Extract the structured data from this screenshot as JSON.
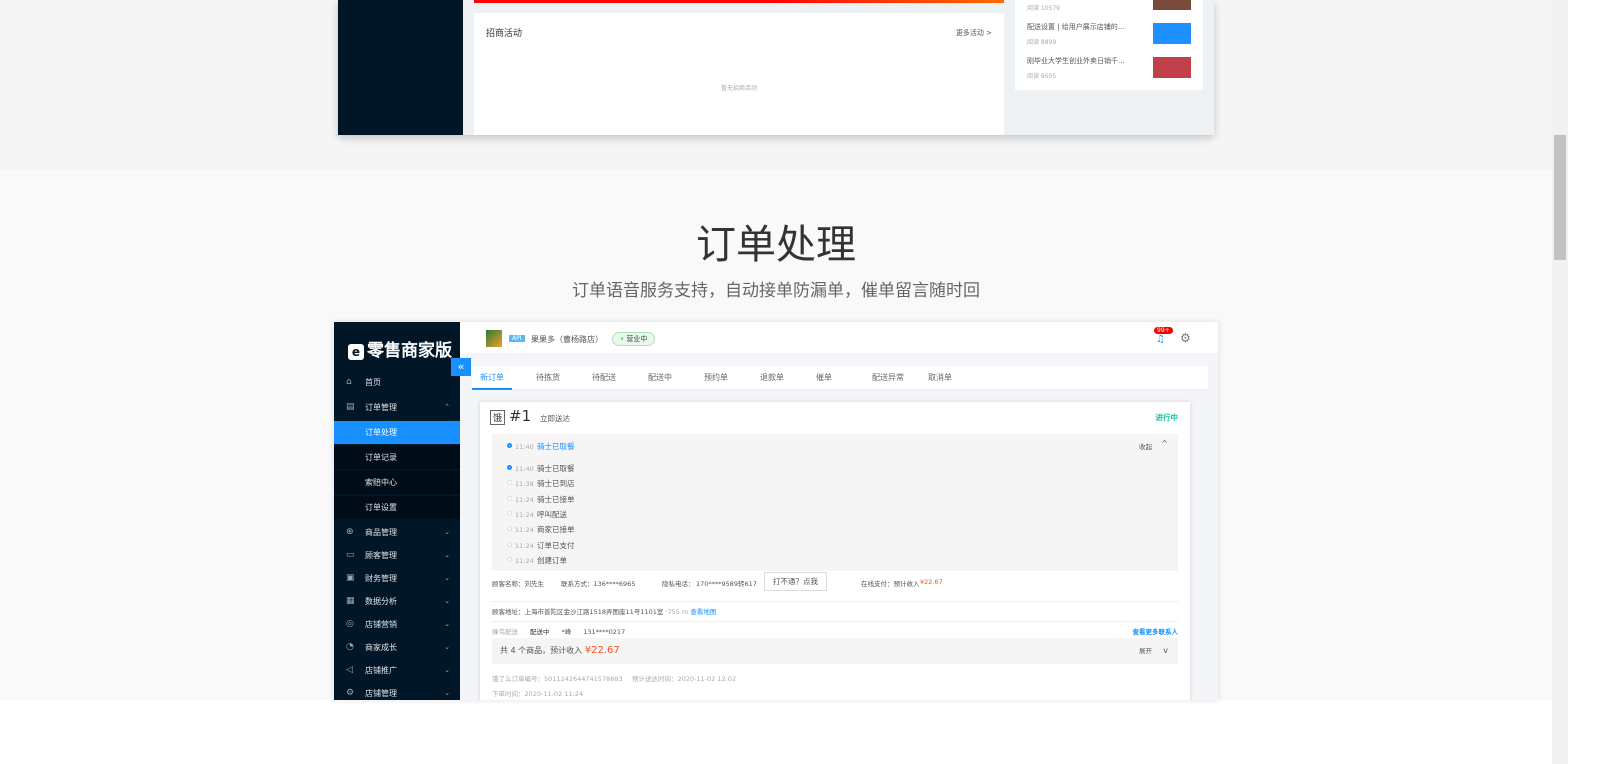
{
  "prev_screenshot": {
    "campaign_title": "招商活动",
    "more_campaigns": "更多活动 >",
    "empty": "暂无招商活动",
    "articles": [
      {
        "title": "",
        "reads": "阅读 10579"
      },
      {
        "title": "配送设置 | 给用户展示店铺的...",
        "reads": "阅读 8899"
      },
      {
        "title": "刚毕业大学生创业外卖日销千...",
        "reads": "阅读 9505"
      }
    ]
  },
  "section": {
    "title": "订单处理",
    "subtitle": "订单语音服务支持，自动接单防漏单，催单留言随时回"
  },
  "app": {
    "logo": "零售商家版",
    "collapse_icon": "«",
    "menu": [
      {
        "label": "首页",
        "icon": "⌂"
      },
      {
        "label": "订单管理",
        "icon": "▤",
        "chevron": "⌃"
      },
      {
        "label": "订单处理",
        "sub": true,
        "active": true
      },
      {
        "label": "订单记录",
        "sub": true
      },
      {
        "label": "索赔中心",
        "sub": true
      },
      {
        "label": "订单设置",
        "sub": true
      },
      {
        "label": "商品管理",
        "icon": "⊕",
        "chevron": "⌄"
      },
      {
        "label": "顾客管理",
        "icon": "▭",
        "chevron": "⌄"
      },
      {
        "label": "财务管理",
        "icon": "▣",
        "chevron": "⌄"
      },
      {
        "label": "数据分析",
        "icon": "▦",
        "chevron": "⌄"
      },
      {
        "label": "店铺营销",
        "icon": "◎",
        "chevron": "⌄"
      },
      {
        "label": "商家成长",
        "icon": "◔",
        "chevron": "⌄"
      },
      {
        "label": "店铺推广",
        "icon": "◁",
        "chevron": "⌄"
      },
      {
        "label": "店铺管理",
        "icon": "⚙",
        "chevron": "⌄"
      }
    ],
    "header": {
      "api": "API",
      "store": "果果多（曹杨路店）",
      "status": "营业中",
      "badge": "99+"
    },
    "tabs": [
      "新订单",
      "待拣货",
      "待配送",
      "配送中",
      "预约单",
      "退款单",
      "催单",
      "配送异常",
      "取消单"
    ],
    "order": {
      "tag": "饿",
      "number": "#1",
      "delivery": "立即送达",
      "state": "进行中",
      "latest": {
        "time": "11:40",
        "text": "骑士已取餐"
      },
      "collapse": "收起",
      "timeline": [
        {
          "time": "11:40",
          "text": "骑士已取餐"
        },
        {
          "time": "11:38",
          "text": "骑士已到店"
        },
        {
          "time": "11:24",
          "text": "骑士已接单"
        },
        {
          "time": "11:24",
          "text": "呼叫配送"
        },
        {
          "time": "11:24",
          "text": "商家已接单"
        },
        {
          "time": "11:24",
          "text": "订单已支付"
        },
        {
          "time": "11:24",
          "text": "创建订单"
        }
      ],
      "customer": "顾客名称：刘先生",
      "contact": "联系方式：136****6965",
      "privacy": "隐私电话：",
      "privacy_num": "170****9589转617",
      "call_btn": "打不通？点我",
      "payment": "在线支付：预计收入",
      "payment_amount": "¥22.67",
      "address": "顾客地址：上海市普陀区金沙江路1518弄图座11号1101室",
      "distance": "·755 m",
      "map": "查看地图",
      "rider_co": "蜂鸟配送",
      "rider_state": "配送中",
      "rider": "*峰",
      "rider_phone": "131****0217",
      "more_contacts": "查看更多联系人",
      "items": "共 4 个商品，预计收入",
      "items_amount": "¥22.67",
      "expand": "展开",
      "order_no": "饿了么订单编号：5011242644741578883",
      "eta": "预计送达时间：2020-11-02 12:02",
      "placed": "下单时间：2020-11-02 11:24"
    }
  }
}
